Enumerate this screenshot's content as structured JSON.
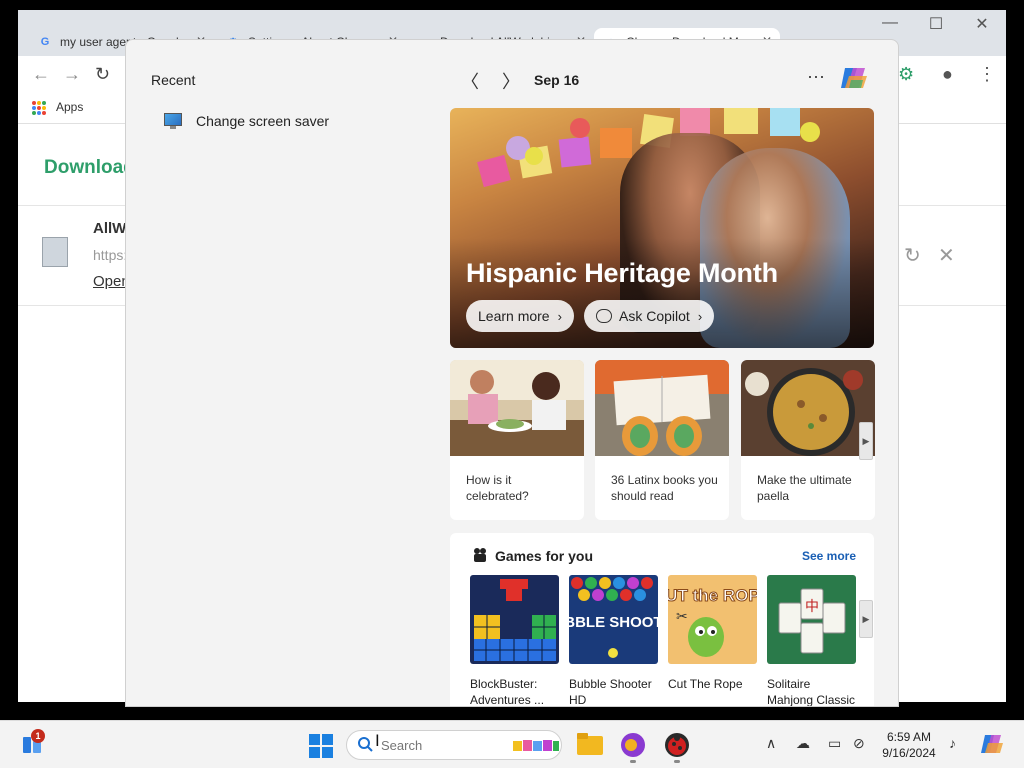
{
  "browser": {
    "tabs": [
      {
        "title": "my user agent - Google",
        "icon": "google-icon"
      },
      {
        "title": "Settings - About Chrome",
        "icon": "settings-gear-icon"
      },
      {
        "title": "Download AllWork bi",
        "icon": "download-site-icon"
      },
      {
        "title": "Chrome Download Ma",
        "icon": "download-page-icon"
      }
    ],
    "bookmarks": {
      "apps_label": "Apps"
    },
    "page": {
      "heading": "Download",
      "item_name": "AllW",
      "item_url": "https:",
      "item_open": "Open"
    }
  },
  "flyout": {
    "recent_heading": "Recent",
    "recent_items": [
      {
        "label": "Change screen saver",
        "icon": "screen-saver-icon"
      }
    ],
    "date": "Sep 16",
    "hero": {
      "title": "Hispanic Heritage Month",
      "learn_more": "Learn more",
      "ask_copilot": "Ask Copilot"
    },
    "cards": [
      {
        "caption": "How is it celebrated?"
      },
      {
        "caption": "36 Latinx books you should read"
      },
      {
        "caption": "Make the ultimate paella"
      }
    ],
    "games": {
      "title": "Games for you",
      "see_more": "See more",
      "items": [
        {
          "name": "BlockBuster: Adventures ...",
          "logo_text": ""
        },
        {
          "name": "Bubble Shooter HD",
          "logo_text": "BUBBLE SHOOTER"
        },
        {
          "name": "Cut The Rope",
          "logo_text": "CUT the ROPE"
        },
        {
          "name": "Solitaire Mahjong Classic",
          "logo_text": "中"
        }
      ]
    }
  },
  "taskbar": {
    "search_placeholder": "Search",
    "notification_badge": "1",
    "time": "6:59 AM",
    "date": "9/16/2024"
  },
  "colors": {
    "accent_link": "#1a5fb4",
    "download_heading": "#2e9e6a",
    "badge_red": "#c42b1c"
  }
}
